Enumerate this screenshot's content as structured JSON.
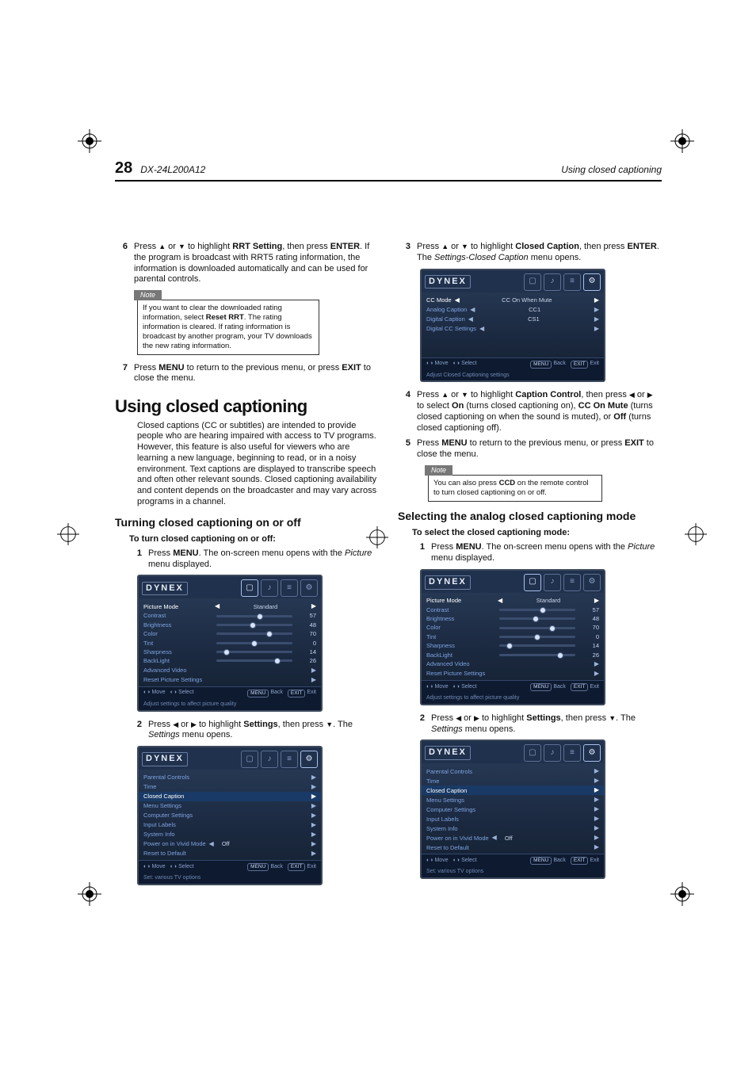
{
  "header": {
    "page_number": "28",
    "model": "DX-24L200A12",
    "section_title": "Using closed captioning"
  },
  "left": {
    "step6": {
      "num": "6",
      "text_a": "Press ",
      "up": "▲",
      "or": " or ",
      "down": "▼",
      "text_b": " to highlight ",
      "rrt": "RRT Setting",
      "text_c": ", then press ",
      "enter": "ENTER",
      "text_d": ". If the program is broadcast with RRT5 rating information, the information is downloaded automatically and can be used for parental controls."
    },
    "note1": {
      "label": "Note",
      "body_a": "If you want to clear the downloaded rating information, select ",
      "reset": "Reset RRT",
      "body_b": ". The rating information is cleared. If rating information is broadcast by another program, your TV downloads the new rating information."
    },
    "step7": {
      "num": "7",
      "text_a": "Press ",
      "menu": "MENU",
      "text_b": " to return to the previous menu, or press ",
      "exit": "EXIT",
      "text_c": " to close the menu."
    },
    "h1": "Using closed captioning",
    "intro": "Closed captions (CC or subtitles) are intended to provide people who are hearing impaired with access to TV programs. However, this feature is also useful for viewers who are learning a new language, beginning to read, or in a noisy environment. Text captions are displayed to transcribe speech and often other relevant sounds. Closed captioning availability and content depends on the broadcaster and may vary across programs in a channel.",
    "h2": "Turning closed captioning on or off",
    "h3": "To turn closed captioning on or off:",
    "step1": {
      "num": "1",
      "a": "Press ",
      "menu": "MENU",
      "b": ". The on-screen menu opens with the ",
      "picture": "Picture",
      "c": " menu displayed."
    },
    "osd_picture": {
      "brand": "DYNEX",
      "tab_label": "Picture",
      "rows": [
        {
          "label": "Picture Mode",
          "value": "Standard",
          "arrow": true
        },
        {
          "label": "Contrast",
          "value": "57",
          "pos": 57
        },
        {
          "label": "Brightness",
          "value": "48",
          "pos": 48
        },
        {
          "label": "Color",
          "value": "70",
          "pos": 70
        },
        {
          "label": "Tint",
          "value": "0",
          "pos": 50
        },
        {
          "label": "Sharpness",
          "value": "14",
          "pos": 14
        },
        {
          "label": "BackLight",
          "value": "26",
          "pos": 80
        },
        {
          "label": "Advanced Video",
          "arrow_only": true
        },
        {
          "label": "Reset Picture Settings",
          "arrow_only": true
        }
      ],
      "foot": {
        "move": "Move",
        "select": "Select",
        "back": "Back",
        "exit": "Exit",
        "back_btn": "MENU",
        "exit_btn": "EXIT"
      },
      "caption": "Adjust settings to affect picture quality"
    },
    "step2": {
      "num": "2",
      "a": "Press ",
      "left": "◀",
      "or": " or ",
      "right": "▶",
      "b": " to highlight ",
      "settings": "Settings",
      "c": ", then press ",
      "down": "▼",
      "d": ". The ",
      "settings_i": "Settings",
      "e": " menu opens."
    },
    "osd_settings": {
      "brand": "DYNEX",
      "tab_label": "Settings",
      "rows": [
        "Parental Controls",
        "Time",
        "Closed Caption",
        "Menu Settings",
        "Computer Settings",
        "Input Labels",
        "System Info",
        "Power on in Vivid Mode",
        "Reset to Default"
      ],
      "vivid_value": "Off",
      "sel_index": 2,
      "foot": {
        "move": "Move",
        "select": "Select",
        "back": "Back",
        "exit": "Exit",
        "back_btn": "MENU",
        "exit_btn": "EXIT"
      },
      "caption": "Set: various TV options"
    }
  },
  "right": {
    "step3": {
      "num": "3",
      "a": "Press ",
      "up": "▲",
      "or": " or ",
      "down": "▼",
      "b": " to highlight ",
      "cc": "Closed Caption",
      "c": ", then press ",
      "enter": "ENTER",
      "d": ". The ",
      "menu_i": "Settings-Closed Caption",
      "e": " menu opens."
    },
    "osd_cc": {
      "brand": "DYNEX",
      "rows": [
        {
          "label": "CC Mode",
          "value": "CC On When Mute"
        },
        {
          "label": "Analog Caption",
          "value": "CC1"
        },
        {
          "label": "Digital Caption",
          "value": "CS1"
        },
        {
          "label": "Digital CC Settings",
          "arrow_only": true
        }
      ],
      "foot": {
        "move": "Move",
        "select": "Select",
        "back": "Back",
        "exit": "Exit",
        "back_btn": "MENU",
        "exit_btn": "EXIT"
      },
      "caption": "Adjust Closed Captioning settings"
    },
    "step4": {
      "num": "4",
      "a": "Press ",
      "up": "▲",
      "or1": " or ",
      "down": "▼",
      "b": " to highlight ",
      "cc_ctrl": "Caption Control",
      "c": ", then press ",
      "left": "◀",
      "or2": " or ",
      "right": "▶",
      "d": " to select ",
      "on": "On",
      "e": " (turns closed captioning on), ",
      "mute": "CC On Mute",
      "f": " (turns closed captioning on when the sound is muted), or ",
      "off": "Off",
      "g": " (turns closed captioning off)."
    },
    "step5": {
      "num": "5",
      "a": "Press ",
      "menu": "MENU",
      "b": " to return to the previous menu, or press ",
      "exit": "EXIT",
      "c": " to close the menu."
    },
    "note2": {
      "label": "Note",
      "a": "You can also press ",
      "ccd": "CCD",
      "b": " on the remote control to turn closed captioning on or off."
    },
    "h2": "Selecting the analog closed captioning mode",
    "h3": "To select the closed captioning mode:",
    "step1": {
      "num": "1",
      "a": "Press ",
      "menu": "MENU",
      "b": ". The on-screen menu opens with the ",
      "picture": "Picture",
      "c": " menu displayed."
    },
    "step2": {
      "num": "2",
      "a": "Press ",
      "left": "◀",
      "or": " or ",
      "right": "▶",
      "b": " to highlight ",
      "settings": "Settings",
      "c": ", then press ",
      "down": "▼",
      "d": ". The ",
      "settings_i": "Settings",
      "e": " menu opens."
    }
  }
}
